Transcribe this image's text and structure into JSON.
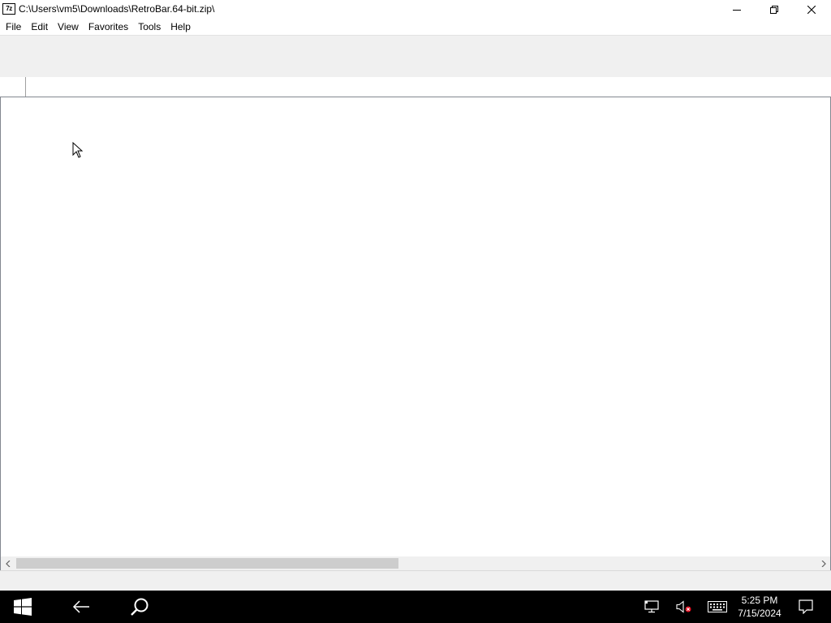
{
  "window": {
    "app_icon_text": "7z",
    "title": "C:\\Users\\vm5\\Downloads\\RetroBar.64-bit.zip\\",
    "controls": [
      "minimize-icon",
      "restore-icon",
      "close-icon"
    ]
  },
  "menu": {
    "items": [
      {
        "label": "File"
      },
      {
        "label": "Edit"
      },
      {
        "label": "View"
      },
      {
        "label": "Favorites"
      },
      {
        "label": "Tools"
      },
      {
        "label": "Help"
      }
    ]
  },
  "address": {
    "value": ""
  },
  "taskbar": {
    "start_icon": "windows-logo-icon",
    "back_icon": "back-arrow-icon",
    "search_icon": "search-icon",
    "tray": {
      "network_icon": "network-icon",
      "volume_icon": "volume-muted-icon",
      "keyboard_icon": "keyboard-icon",
      "time": "5:25 PM",
      "date": "7/15/2024",
      "notification_icon": "action-center-icon"
    }
  },
  "colors": {
    "taskbar_bg": "#000000",
    "toolbar_bg": "#f0f0f0",
    "window_bg": "#ffffff",
    "scroll_thumb": "#cdcdcd"
  }
}
